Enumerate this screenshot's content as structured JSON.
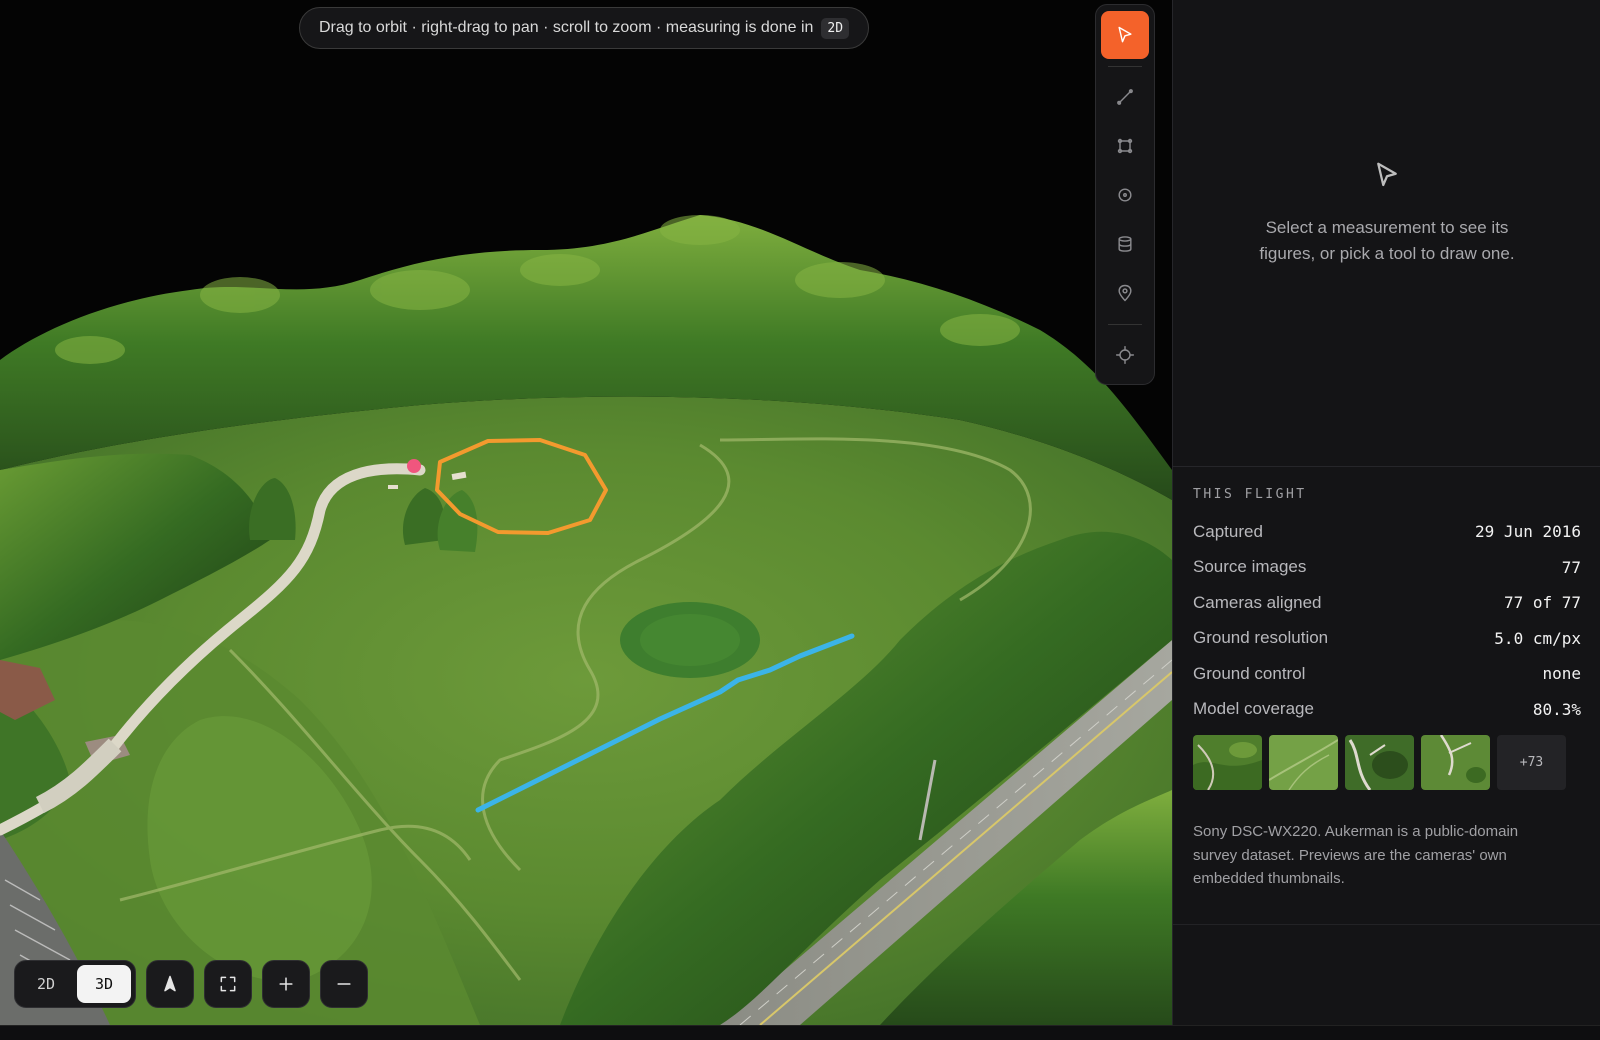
{
  "viewport": {
    "hint": {
      "text": "Drag to orbit · right-drag to pan · scroll to zoom · measuring is done in",
      "badge": "2D"
    }
  },
  "toolbar": {
    "tools": [
      {
        "name": "select",
        "icon": "cursor-icon",
        "active": true
      },
      {
        "name": "distance",
        "icon": "line-icon",
        "active": false
      },
      {
        "name": "area",
        "icon": "polygon-icon",
        "active": false
      },
      {
        "name": "point",
        "icon": "target-dot-icon",
        "active": false
      },
      {
        "name": "volume",
        "icon": "database-icon",
        "active": false
      },
      {
        "name": "marker",
        "icon": "map-pin-icon",
        "active": false
      },
      {
        "name": "locate",
        "icon": "crosshair-icon",
        "active": false
      }
    ]
  },
  "controls": {
    "mode_2d": "2D",
    "mode_3d": "3D",
    "active_mode": "3D",
    "icons": [
      "north-arrow-icon",
      "fullscreen-icon",
      "zoom-in-icon",
      "zoom-out-icon"
    ]
  },
  "panel": {
    "empty_message": "Select a measurement to see its figures, or pick a tool to draw one.",
    "flight": {
      "heading": "THIS FLIGHT",
      "rows": [
        {
          "label": "Captured",
          "value": "29 Jun 2016"
        },
        {
          "label": "Source images",
          "value": "77"
        },
        {
          "label": "Cameras aligned",
          "value": "77 of 77"
        },
        {
          "label": "Ground resolution",
          "value": "5.0 cm/px"
        },
        {
          "label": "Ground control",
          "value": "none"
        },
        {
          "label": "Model coverage",
          "value": "80.3%"
        }
      ],
      "more_thumbs": "+73",
      "note": "Sony DSC-WX220. Aukerman is a public-domain survey dataset. Previews are the cameras' own embedded thumbnails."
    }
  },
  "colors": {
    "accent": "#f4622a",
    "polygon_measure": "#f39a2e",
    "line_measure": "#3bb4e8",
    "point_marker": "#f0567e"
  }
}
